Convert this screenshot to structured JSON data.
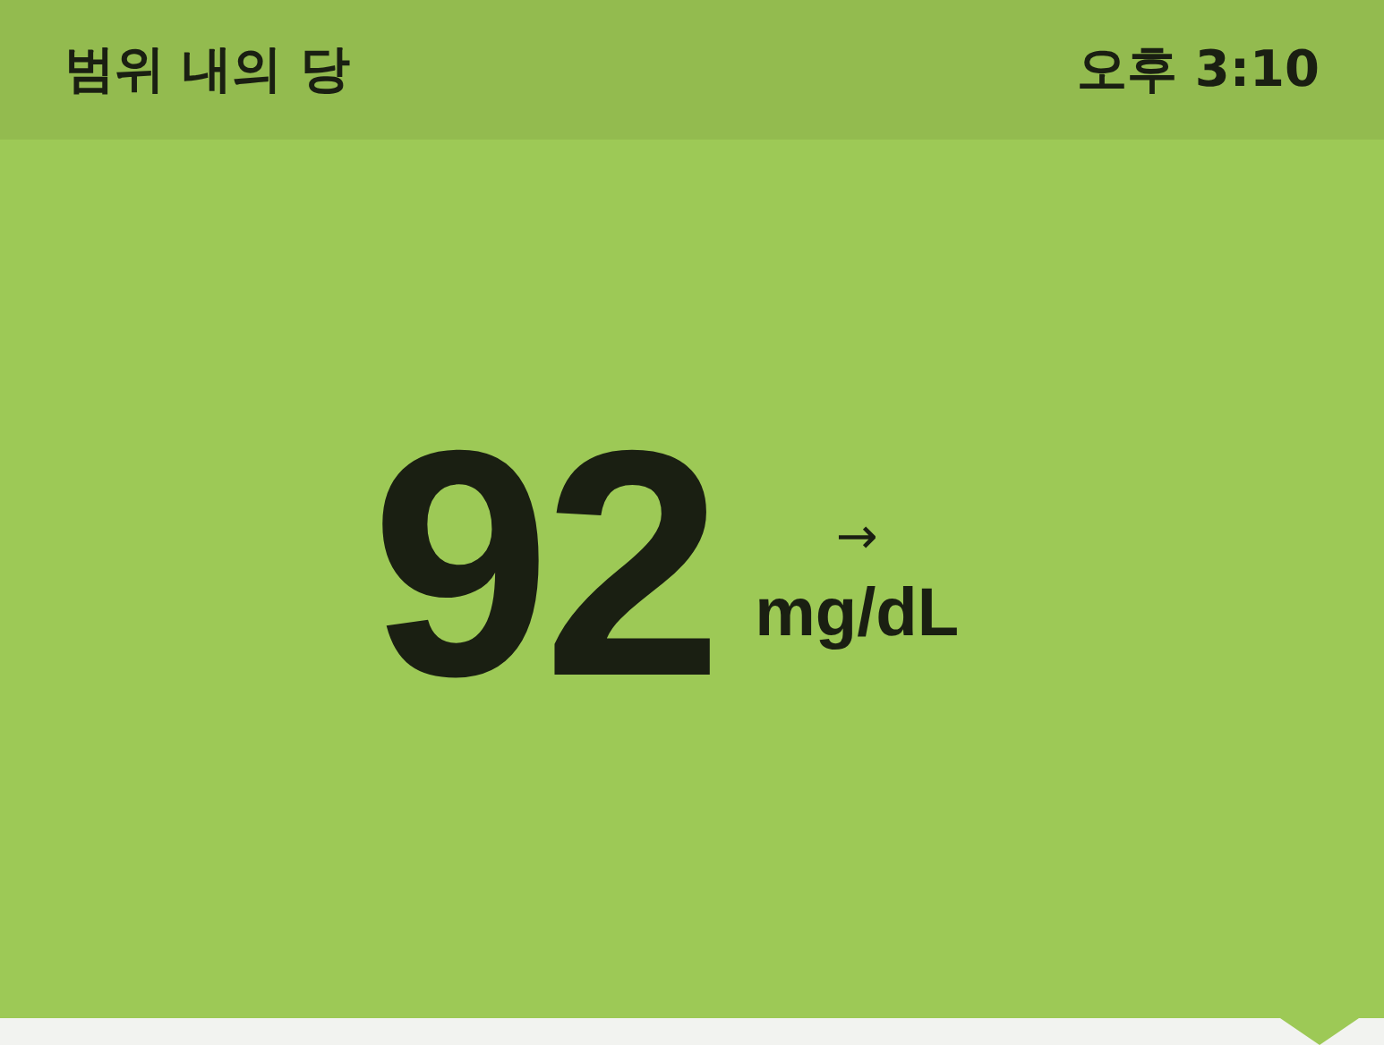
{
  "header": {
    "title": "범위 내의 당",
    "time": "오후 3:10"
  },
  "reading": {
    "value": "92",
    "trend_arrow": "→",
    "unit": "mg/dL"
  }
}
